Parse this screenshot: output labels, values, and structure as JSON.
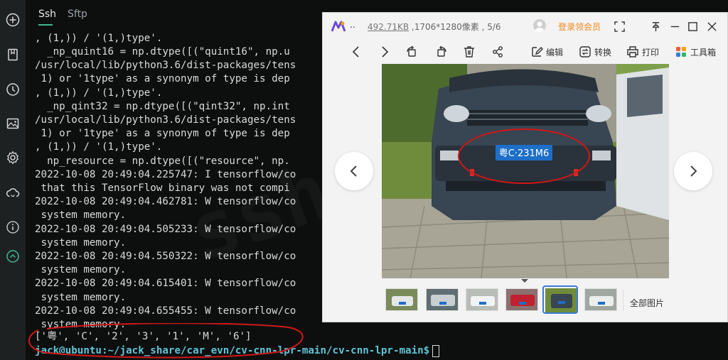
{
  "sidebar": {
    "icons": [
      "add-circle-icon",
      "bookmark-icon",
      "history-clock-icon",
      "image-icon",
      "settings-gear-icon",
      "cloud-sync-icon",
      "info-icon",
      "collapse-up-icon"
    ]
  },
  "tabs": [
    {
      "label": "Ssh",
      "active": true
    },
    {
      "label": "Sftp",
      "active": false
    }
  ],
  "terminal": {
    "lines": [
      ", (1,)) / '(1,)type'.",
      "  _np_quint16 = np.dtype([(\"quint16\", np.u",
      "/usr/local/lib/python3.6/dist-packages/tens",
      " 1) or '1type' as a synonym of type is dep",
      ", (1,)) / '(1,)type'.",
      "  _np_qint32 = np.dtype([(\"qint32\", np.int",
      "/usr/local/lib/python3.6/dist-packages/tens",
      " 1) or '1type' as a synonym of type is dep",
      ", (1,)) / '(1,)type'.",
      "  np_resource = np.dtype([(\"resource\", np.",
      "2022-10-08 20:49:04.225747: I tensorflow/co",
      " that this TensorFlow binary was not compi",
      "2022-10-08 20:49:04.462781: W tensorflow/co",
      " system memory.",
      "2022-10-08 20:49:04.505233: W tensorflow/co",
      " system memory.",
      "2022-10-08 20:49:04.550322: W tensorflow/co",
      " system memory.",
      "2022-10-08 20:49:04.615401: W tensorflow/co",
      " system memory.",
      "2022-10-08 20:49:04.655455: W tensorflow/co",
      " system memory.",
      "['粤', 'C', '2', '3', '1', 'M', '6']"
    ],
    "prompt_user": "jack@ubuntu",
    "prompt_path": ":~/jack_share/car_evn/cv-cnn-lpr-main/cv-cnn-lpr-main$",
    "accent_color": "#5fc4d6"
  },
  "viewer": {
    "title_dots": "..",
    "file_size": "492.71KB",
    "info_rest": " ,1706*1280像素 , 5/6",
    "member_label": "登录领会员",
    "member_color": "#f08a1a",
    "toolbar": {
      "edit_label": "编辑",
      "convert_label": "转换",
      "print_label": "打印",
      "toolbox_label": "工具箱"
    },
    "plate_text": "粤C·231M6",
    "all_pictures_label": "全部图片",
    "thumbnail_count": 6,
    "selected_thumbnail": 5
  },
  "annotation_color": "#d01818"
}
